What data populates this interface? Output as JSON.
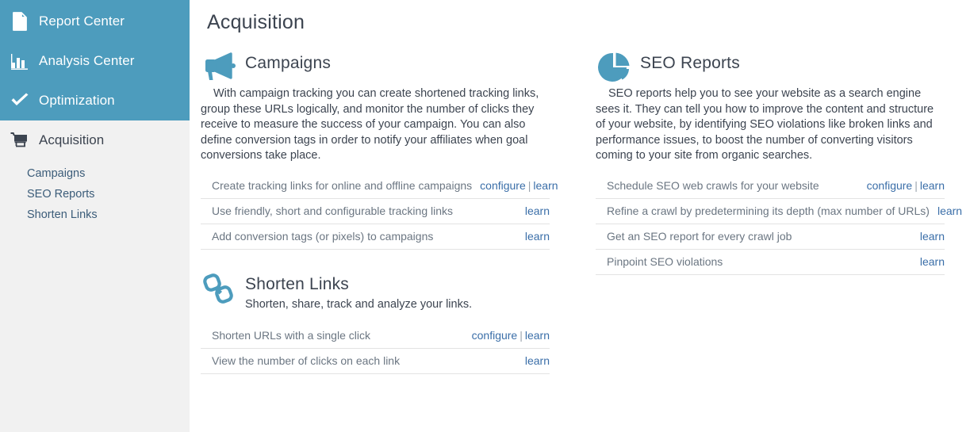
{
  "sidebar": {
    "nav_items": [
      {
        "label": "Report Center",
        "icon": "document-icon"
      },
      {
        "label": "Analysis Center",
        "icon": "bar-chart-icon"
      },
      {
        "label": "Optimization",
        "icon": "check-icon"
      }
    ],
    "section": {
      "label": "Acquisition",
      "icon": "shopping-cart-icon"
    },
    "sub_items": [
      {
        "label": "Campaigns"
      },
      {
        "label": "SEO Reports"
      },
      {
        "label": "Shorten Links"
      }
    ]
  },
  "main": {
    "page_title": "Acquisition",
    "cards": [
      {
        "id": "campaigns",
        "icon": "megaphone-icon",
        "title": "Campaigns",
        "description": "With campaign tracking you can create shortened tracking links, group these URLs logically, and monitor the number of clicks they receive to measure the success of your campaign. You can also define conversion tags in order to notify your affiliates when goal conversions take place.",
        "rows": [
          {
            "label": "Create tracking links for online and offline campaigns",
            "configure": "configure",
            "separator": "|",
            "learn": "learn"
          },
          {
            "label": "Use friendly, short and configurable tracking links",
            "configure": "",
            "separator": "",
            "learn": "learn"
          },
          {
            "label": "Add conversion tags (or pixels) to campaigns",
            "configure": "",
            "separator": "",
            "learn": "learn"
          }
        ]
      },
      {
        "id": "shorten-links",
        "icon": "chain-link-icon",
        "title": "Shorten Links",
        "description": "Shorten, share, track and analyze your links.",
        "rows": [
          {
            "label": "Shorten URLs with a single click",
            "configure": "configure",
            "separator": "|",
            "learn": "learn"
          },
          {
            "label": "View the number of clicks on each link",
            "configure": "",
            "separator": "",
            "learn": "learn"
          }
        ]
      },
      {
        "id": "seo-reports",
        "icon": "pie-chart-icon",
        "title": "SEO Reports",
        "description": "SEO reports help you to see your website as a search engine sees it. They can tell you how to improve the content and structure of your website, by identifying SEO violations like broken links and performance issues, to boost the number of converting visitors coming to your site from organic searches.",
        "rows": [
          {
            "label": "Schedule SEO web crawls for your website",
            "configure": "configure",
            "separator": "|",
            "learn": "learn"
          },
          {
            "label": "Refine a crawl by predetermining its depth (max number of URLs)",
            "configure": "",
            "separator": "",
            "learn": "learn"
          },
          {
            "label": "Get an SEO report for every crawl job",
            "configure": "",
            "separator": "",
            "learn": "learn"
          },
          {
            "label": "Pinpoint SEO violations",
            "configure": "",
            "separator": "",
            "learn": "learn"
          }
        ]
      }
    ]
  },
  "colors": {
    "sidebar_accent": "#4d9cbd",
    "sidebar_bg": "#f1f1f1",
    "link": "#3a6ea8",
    "text_dark": "#3c4450",
    "text_muted": "#6b7682",
    "divider": "#e3e3e3"
  }
}
